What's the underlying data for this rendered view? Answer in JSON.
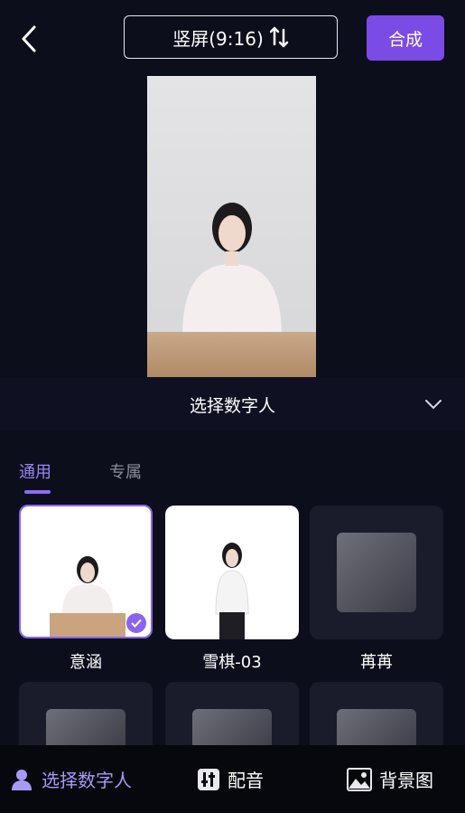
{
  "header": {
    "ratio_label": "竖屏(9:16)",
    "compose_label": "合成"
  },
  "selector": {
    "label": "选择数字人"
  },
  "tabs": [
    {
      "label": "通用"
    },
    {
      "label": "专属"
    }
  ],
  "avatars": [
    {
      "name": "意涵",
      "selected": true
    },
    {
      "name": "雪棋-03",
      "selected": false
    },
    {
      "name": "苒苒",
      "selected": false
    }
  ],
  "bottom_nav": [
    {
      "label": "选择数字人",
      "icon": "person-icon",
      "active": true
    },
    {
      "label": "配音",
      "icon": "equalizer-icon",
      "active": false
    },
    {
      "label": "背景图",
      "icon": "image-icon",
      "active": false
    }
  ],
  "colors": {
    "accent": "#7b4be6",
    "background": "#0d0e1c"
  }
}
